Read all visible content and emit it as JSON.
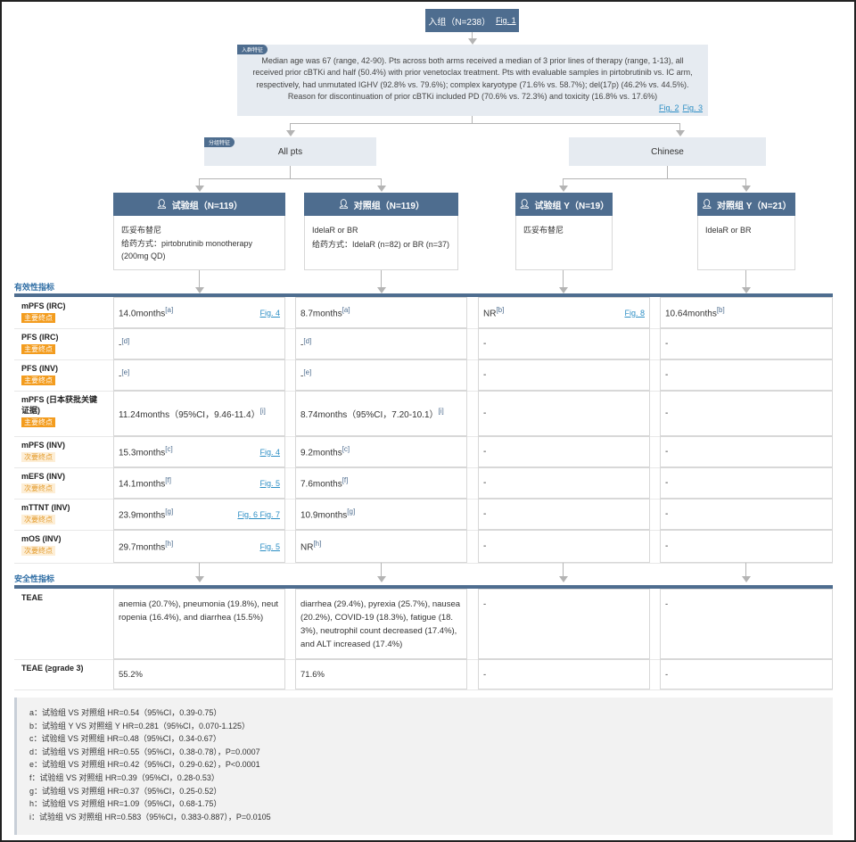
{
  "enroll": {
    "label": "入组（N=238）",
    "link": "Fig. 1"
  },
  "baseline": {
    "tag": "入群特征",
    "text": "Median age was 67 (range, 42-90). Pts across both arms received a median of 3 prior lines of therapy (range, 1-13), all received prior cBTKi and half (50.4%) with prior venetoclax treatment. Pts with evaluable samples in pirtobrutinib vs. IC arm, respectively, had unmutated IGHV (92.8% vs. 79.6%); complex karyotype (71.6% vs. 58.7%); del(17p) (46.2% vs. 44.5%). Reason for discontinuation of prior cBTKi included PD (70.6% vs. 72.3%) and toxicity (16.8% vs. 17.6%)",
    "links": [
      "Fig. 2",
      "Fig. 3"
    ]
  },
  "subgroups": {
    "tag": "分组特征",
    "all": "All pts",
    "chinese": "Chinese"
  },
  "arms": [
    {
      "title": "试验组（N=119）",
      "line1": "匹妥布替尼",
      "line2": "给药方式：pirtobrutinib monotherapy (200mg QD)"
    },
    {
      "title": "对照组（N=119）",
      "line1": "IdelaR or BR",
      "line2": "给药方式：IdelaR (n=82) or BR (n=37)"
    },
    {
      "title": "试验组 Y（N=19）",
      "line1": "匹妥布替尼",
      "line2": ""
    },
    {
      "title": "对照组 Y（N=21）",
      "line1": "IdelaR or BR",
      "line2": ""
    }
  ],
  "efficacy_title": "有效性指标",
  "safety_title": "安全性指标",
  "efficacy_rows": [
    {
      "label": "mPFS (IRC)",
      "badge": "主要终点",
      "primary": true,
      "cells": [
        {
          "v": "14.0months",
          "s": "[a]",
          "l": "Fig. 4"
        },
        {
          "v": "8.7months",
          "s": "[a]",
          "l": ""
        },
        {
          "v": "NR",
          "s": "[b]",
          "l": "Fig. 8"
        },
        {
          "v": "10.64months",
          "s": "[b]",
          "l": ""
        }
      ]
    },
    {
      "label": "PFS (IRC)",
      "badge": "主要终点",
      "primary": true,
      "cells": [
        {
          "v": "-",
          "s": "[d]",
          "l": ""
        },
        {
          "v": "-",
          "s": "[d]",
          "l": ""
        },
        {
          "v": "-",
          "s": "",
          "l": ""
        },
        {
          "v": "-",
          "s": "",
          "l": ""
        }
      ]
    },
    {
      "label": "PFS (INV)",
      "badge": "主要终点",
      "primary": true,
      "cells": [
        {
          "v": "-",
          "s": "[e]",
          "l": ""
        },
        {
          "v": "-",
          "s": "[e]",
          "l": ""
        },
        {
          "v": "-",
          "s": "",
          "l": ""
        },
        {
          "v": "-",
          "s": "",
          "l": ""
        }
      ]
    },
    {
      "label": "mPFS (日本获批关键证据)",
      "badge": "主要终点",
      "primary": true,
      "cells": [
        {
          "v": "11.24months（95%CI，9.46-11.4）",
          "s": "[i]",
          "l": ""
        },
        {
          "v": "8.74months（95%CI，7.20-10.1）",
          "s": "[i]",
          "l": ""
        },
        {
          "v": "-",
          "s": "",
          "l": ""
        },
        {
          "v": "-",
          "s": "",
          "l": ""
        }
      ]
    },
    {
      "label": "mPFS (INV)",
      "badge": "次要终点",
      "primary": false,
      "cells": [
        {
          "v": "15.3months",
          "s": "[c]",
          "l": "Fig. 4"
        },
        {
          "v": "9.2months",
          "s": "[c]",
          "l": ""
        },
        {
          "v": "-",
          "s": "",
          "l": ""
        },
        {
          "v": "-",
          "s": "",
          "l": ""
        }
      ]
    },
    {
      "label": "mEFS (INV)",
      "badge": "次要终点",
      "primary": false,
      "cells": [
        {
          "v": "14.1months",
          "s": "[f]",
          "l": "Fig. 5"
        },
        {
          "v": "7.6months",
          "s": "[f]",
          "l": ""
        },
        {
          "v": "-",
          "s": "",
          "l": ""
        },
        {
          "v": "-",
          "s": "",
          "l": ""
        }
      ]
    },
    {
      "label": "mTTNT (INV)",
      "badge": "次要终点",
      "primary": false,
      "cells": [
        {
          "v": "23.9months",
          "s": "[g]",
          "l": "Fig. 6  Fig. 7"
        },
        {
          "v": "10.9months",
          "s": "[g]",
          "l": ""
        },
        {
          "v": "-",
          "s": "",
          "l": ""
        },
        {
          "v": "-",
          "s": "",
          "l": ""
        }
      ]
    },
    {
      "label": "mOS (INV)",
      "badge": "次要终点",
      "primary": false,
      "cells": [
        {
          "v": "29.7months",
          "s": "[h]",
          "l": "Fig. 5"
        },
        {
          "v": "NR",
          "s": "[h]",
          "l": ""
        },
        {
          "v": "-",
          "s": "",
          "l": ""
        },
        {
          "v": "-",
          "s": "",
          "l": ""
        }
      ]
    }
  ],
  "safety_rows": [
    {
      "label": "TEAE",
      "cells": [
        "anemia (20.7%), pneumonia (19.8%), neutropenia (16.4%), and diarrhea (15.5%)",
        "diarrhea (29.4%), pyrexia (25.7%), nausea (20.2%), COVID-19 (18.3%), fatigue (18.3%), neutrophil count decreased (17.4%), and ALT increased (17.4%)",
        "-",
        "-"
      ]
    },
    {
      "label": "TEAE (≥grade 3)",
      "cells": [
        "55.2%",
        "71.6%",
        "-",
        "-"
      ]
    }
  ],
  "notes": [
    "a：试验组 VS 对照组 HR=0.54（95%CI，0.39-0.75）",
    "b：试验组 Y VS 对照组 Y HR=0.281（95%CI，0.070-1.125）",
    "c：试验组 VS 对照组 HR=0.48（95%CI，0.34-0.67）",
    "d：试验组 VS 对照组 HR=0.55（95%CI，0.38-0.78），P=0.0007",
    "e：试验组 VS 对照组 HR=0.42（95%CI，0.29-0.62），P<0.0001",
    "f：试验组 VS 对照组 HR=0.39（95%CI，0.28-0.53）",
    "g：试验组 VS 对照组 HR=0.37（95%CI，0.25-0.52）",
    "h：试验组 VS 对照组 HR=1.09（95%CI，0.68-1.75）",
    "i：试验组 VS 对照组 HR=0.583（95%CI，0.383-0.887），P=0.0105"
  ],
  "colors": {
    "navy": "#4e6d8f",
    "primary_badge": "#f39c1e",
    "secondary_badge": "#fdeed6",
    "link": "#2e8fc5"
  }
}
